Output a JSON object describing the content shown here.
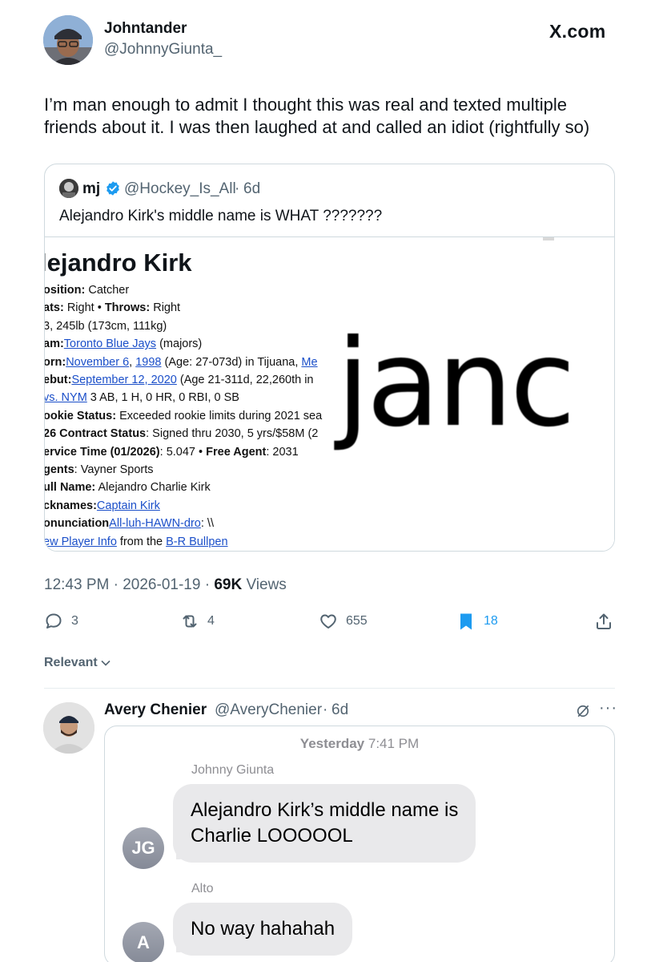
{
  "header": {
    "author_name": "Johntander",
    "author_handle": "@JohnnyGiunta_",
    "site_logo": "X.com"
  },
  "tweet": {
    "text": "I’m man enough to admit I thought this was real and texted multiple friends about it. I was then laughed at and called an idiot (rightfully so)"
  },
  "quote": {
    "name": "mj",
    "handle": "@Hockey_Is_All",
    "separator": "·",
    "time": "6d",
    "text": "Alejandro Kirk's middle name is WHAT ???????",
    "media": {
      "title": "lejandro Kirk",
      "lines": [
        {
          "label": "osition:",
          "value": " Catcher"
        },
        {
          "label": "ats:",
          "value": " Right  •  ",
          "label2": "Throws:",
          "value2": " Right"
        },
        {
          "label": "",
          "value": "3, 245lb (173cm, 111kg)"
        },
        {
          "label": "am:",
          "link": "Toronto Blue Jays",
          "value": " (majors)"
        },
        {
          "label": "orn:",
          "link": "November 6",
          "value": ", ",
          "link2": "1998",
          "value2": " (Age: 27-073d) in Tijuana, ",
          "link3": "Me"
        },
        {
          "label": "ebut:",
          "link": "September 12, 2020",
          "value": " (Age 21-311d, 22,260th in"
        },
        {
          "label": "",
          "link": "vs. NYM",
          "value": " 3 AB, 1 H, 0 HR, 0 RBI, 0 SB"
        },
        {
          "label": "ookie Status:",
          "value": " Exceeded rookie limits during 2021 sea"
        },
        {
          "label": "26 Contract Status",
          "value": ": Signed thru 2030, 5 yrs/$58M (2"
        },
        {
          "label": "ervice Time (01/2026)",
          "value": ": 5.047  •  ",
          "label2": "Free Agent",
          "value2": ": 2031"
        },
        {
          "label": "gents",
          "value": ": Vayner Sports"
        },
        {
          "label": "ull Name:",
          "value": " Alejandro Charlie Kirk"
        },
        {
          "label": "cknames:",
          "link": "Captain Kirk",
          "value": ""
        },
        {
          "label": "onunciation",
          "value": ": \\",
          "link": "All-luh-HAWN-dro",
          "value2": "\\"
        },
        {
          "label": "",
          "link": "ew Player Info",
          "value": " from the ",
          "link2": "B-R Bullpen"
        }
      ],
      "zoom_text": "janc"
    }
  },
  "meta": {
    "time": "12:43 PM",
    "sep": "·",
    "date": "2026-01-19",
    "views_count": "69K",
    "views_label": "Views"
  },
  "actions": {
    "replies": "3",
    "reposts": "4",
    "likes": "655",
    "bookmarks": "18"
  },
  "sort": {
    "label": "Relevant"
  },
  "reply": {
    "name": "Avery Chenier",
    "handle": "@AveryChenier",
    "separator": "·",
    "time": "6d",
    "more": "···",
    "sms": {
      "day": "Yesterday",
      "time": "7:41 PM",
      "messages": [
        {
          "sender": "Johnny Giunta",
          "initials": "JG",
          "lines": [
            "Alejandro Kirk’s middle name is",
            "Charlie LOOOOOL"
          ]
        },
        {
          "sender": "Alto",
          "initials": "A",
          "lines": [
            "No way hahahah"
          ]
        }
      ]
    }
  },
  "colors": {
    "text": "#0f1419",
    "muted": "#536471",
    "bookmark": "#1d9bf0",
    "link": "#1b4fc9",
    "bubble": "#e9e9eb"
  }
}
